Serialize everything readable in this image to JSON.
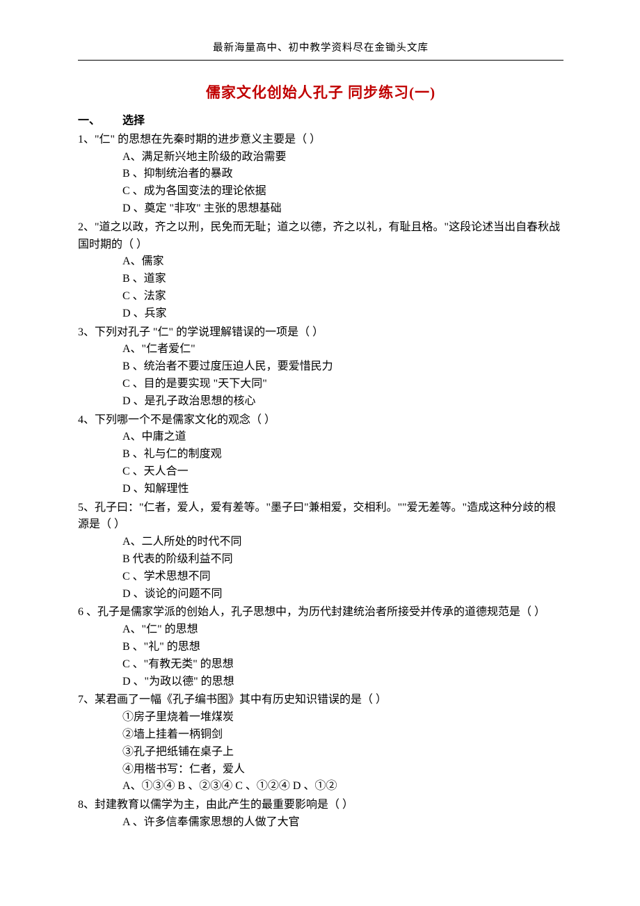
{
  "header": "最新海量高中、初中教学资料尽在金锄头文库",
  "title": "儒家文化创始人孔子 同步练习(一)",
  "section": {
    "num": "一、",
    "label": "选择"
  },
  "q1": {
    "stem": "1、\"仁\" 的思想在先秦时期的进步意义主要是（     ）",
    "A": "A、满足新兴地主阶级的政治需要",
    "B": "B 、抑制统治者的暴政",
    "C": "C 、成为各国变法的理论依据",
    "D": "D 、奠定 \"非攻\" 主张的思想基础"
  },
  "q2": {
    "stem": "2、\"道之以政，齐之以刑，民免而无耻；道之以德，齐之以礼，有耻且格。\"这段论述当出自春秋战国时期的（     ）",
    "A": "A、儒家",
    "B": "B 、道家",
    "C": "C 、法家",
    "D": "D 、兵家"
  },
  "q3": {
    "stem": "3、下列对孔子 \"仁\" 的学说理解错误的一项是（     ）",
    "A": "A、\"仁者爱仁\"",
    "B": "B 、统治者不要过度压迫人民，要爱惜民力",
    "C": "C 、目的是要实现 \"天下大同\"",
    "D": "D 、是孔子政治思想的核心"
  },
  "q4": {
    "stem": "4、下列哪一个不是儒家文化的观念（     ）",
    "A": "A、中庸之道",
    "B": "B 、礼与仁的制度观",
    "C": "C 、天人合一",
    "D": "D 、知解理性"
  },
  "q5": {
    "stem": "5、孔子曰：\"仁者，爱人，爱有差等。\"墨子曰\"兼相爱，交相利。\"\"爱无差等。\"造成这种分歧的根源是（     ）",
    "A": "A、二人所处的时代不同",
    "B": "B  代表的阶级利益不同",
    "C": "C 、学术思想不同",
    "D": "D 、谈论的问题不同"
  },
  "q6": {
    "stem": "6 、孔子是儒家学派的创始人，孔子思想中，为历代封建统治者所接受并传承的道德规范是（     ）",
    "A": "A、\"仁\" 的思想",
    "B": "B 、\"礼\" 的思想",
    "C": "C 、\"有教无类\" 的思想",
    "D": "D 、\"为政以德\" 的思想"
  },
  "q7": {
    "stem": "7、某君画了一幅《孔子编书图》其中有历史知识错误的是（     ）",
    "i1": "①房子里烧着一堆煤炭",
    "i2": "②墙上挂着一柄铜剑",
    "i3": "③孔子把纸铺在桌子上",
    "i4": "④用楷书写：仁者，爱人",
    "opts": "A、①③④     B 、②③④     C 、①②④     D 、①②"
  },
  "q8": {
    "stem": "8、封建教育以儒学为主，由此产生的最重要影响是（     ）",
    "A": "A 、许多信奉儒家思想的人做了大官"
  }
}
